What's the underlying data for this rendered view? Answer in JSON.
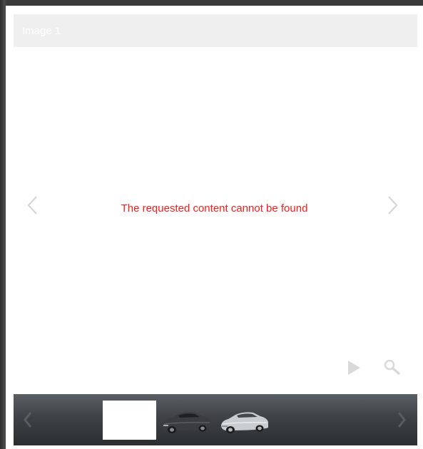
{
  "lightbox": {
    "title": "Image 1",
    "error_message": "The requested content cannot be found"
  },
  "icons": {
    "prev": "chevron-left-icon",
    "next": "chevron-right-icon",
    "play": "play-icon",
    "zoom": "magnifier-icon"
  },
  "thumbnails": [
    {
      "kind": "blank"
    },
    {
      "kind": "dark-sedan"
    },
    {
      "kind": "silver-sedan"
    }
  ],
  "colors": {
    "error": "#ff1a1a",
    "title_bar": "#efefef",
    "strip": "#3e4246"
  }
}
